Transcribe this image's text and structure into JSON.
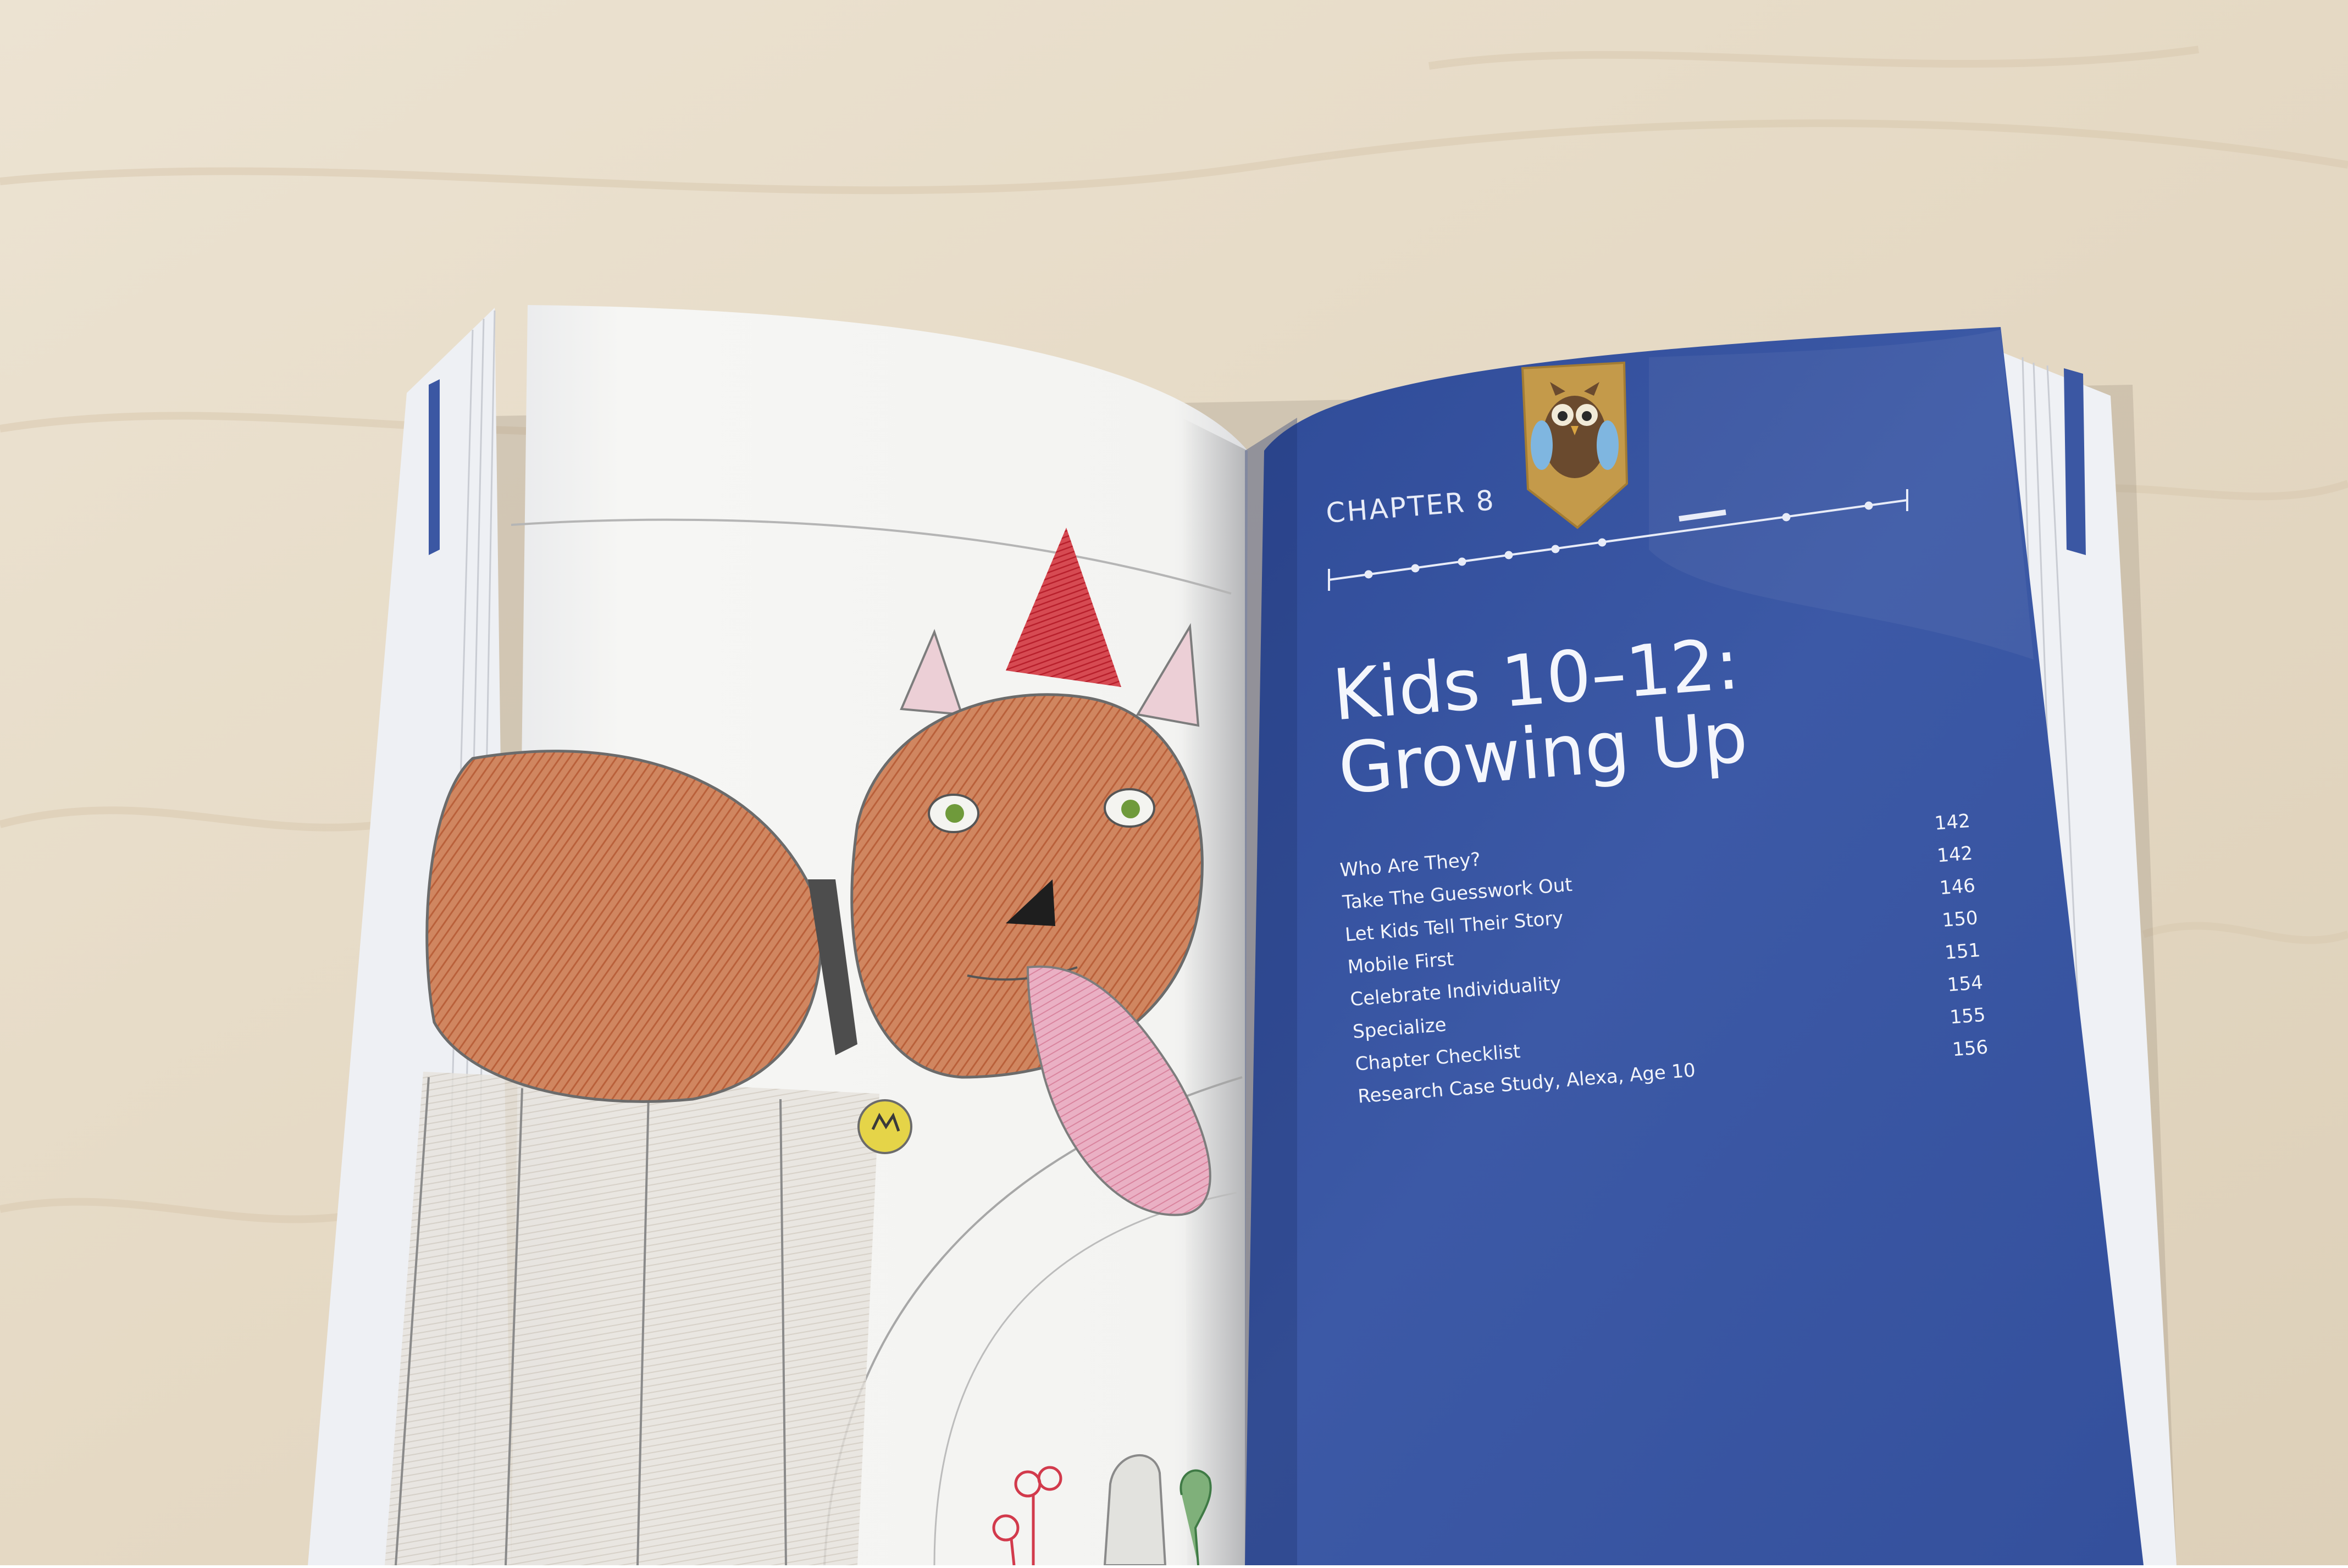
{
  "book": {
    "chapter_label": "CHAPTER 8",
    "chapter_title_line1": "Kids 10–12:",
    "chapter_title_line2": "Growing Up",
    "toc": [
      {
        "title": "Who Are They?",
        "page": "142"
      },
      {
        "title": "Take The Guesswork Out",
        "page": "142"
      },
      {
        "title": "Let Kids Tell Their Story",
        "page": "146"
      },
      {
        "title": "Mobile First",
        "page": "150"
      },
      {
        "title": "Celebrate Individuality",
        "page": "151"
      },
      {
        "title": "Specialize",
        "page": "154"
      },
      {
        "title": "Chapter Checklist",
        "page": "155"
      },
      {
        "title": "Research Case Study, Alexa, Age 10",
        "page": "156"
      }
    ]
  },
  "colors": {
    "desk": "#e7dcc8",
    "page_blue": "#3b57a3",
    "paper": "#f5f5f3",
    "fox_orange": "#c8744a",
    "hat_red": "#c72a35",
    "bookmark_gold": "#c49a4a"
  },
  "icons": [
    "owl-bookmark-icon"
  ]
}
